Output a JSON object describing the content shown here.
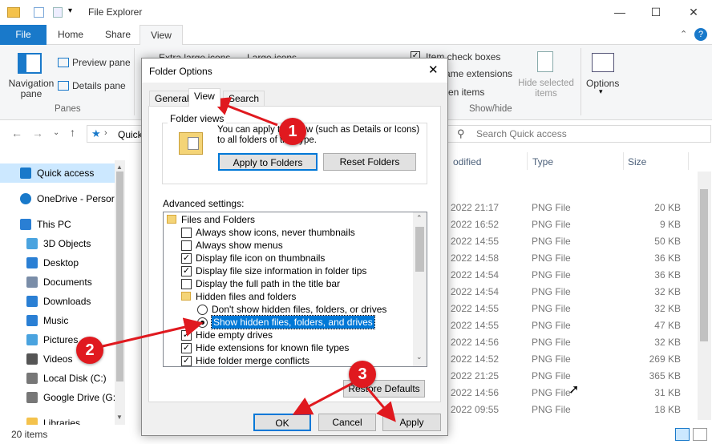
{
  "window": {
    "title": "File Explorer",
    "tabs": [
      "File",
      "Home",
      "Share",
      "View"
    ],
    "status_items": "20 items"
  },
  "ribbon": {
    "navigation_pane": "Navigation pane",
    "preview_pane": "Preview pane",
    "details_pane": "Details pane",
    "panes_group": "Panes",
    "extra_large_icons": "Extra large icons",
    "large_icons": "Large icons",
    "item_check_boxes": "Item check boxes",
    "file_name_extensions": "ame extensions",
    "hidden_items": "en items",
    "hide_selected_items": "Hide selected items",
    "show_hide_group": "Show/hide",
    "options": "Options"
  },
  "nav": {
    "address": "Quick",
    "search_placeholder": "Search Quick access"
  },
  "sidebar": {
    "items": [
      {
        "label": "Quick access",
        "icon": "star-icon"
      },
      {
        "label": "OneDrive - Persor",
        "icon": "cloud-icon"
      },
      {
        "label": "This PC",
        "icon": "computer-icon"
      },
      {
        "label": "3D Objects",
        "icon": "cube-icon"
      },
      {
        "label": "Desktop",
        "icon": "desktop-icon"
      },
      {
        "label": "Documents",
        "icon": "document-icon"
      },
      {
        "label": "Downloads",
        "icon": "download-icon"
      },
      {
        "label": "Music",
        "icon": "music-icon"
      },
      {
        "label": "Pictures",
        "icon": "pictures-icon"
      },
      {
        "label": "Videos",
        "icon": "video-icon"
      },
      {
        "label": "Local Disk (C:)",
        "icon": "drive-icon"
      },
      {
        "label": "Google Drive (G:",
        "icon": "drive-icon"
      },
      {
        "label": "Libraries",
        "icon": "library-icon"
      }
    ]
  },
  "file_list": {
    "columns": [
      "odified",
      "Type",
      "Size"
    ],
    "rows": [
      {
        "modified": "2022 21:17",
        "type": "PNG File",
        "size": "20 KB"
      },
      {
        "modified": "2022 16:52",
        "type": "PNG File",
        "size": "9 KB"
      },
      {
        "modified": "2022 14:55",
        "type": "PNG File",
        "size": "50 KB"
      },
      {
        "modified": "2022 14:58",
        "type": "PNG File",
        "size": "36 KB"
      },
      {
        "modified": "2022 14:54",
        "type": "PNG File",
        "size": "36 KB"
      },
      {
        "modified": "2022 14:54",
        "type": "PNG File",
        "size": "32 KB"
      },
      {
        "modified": "2022 14:55",
        "type": "PNG File",
        "size": "32 KB"
      },
      {
        "modified": "2022 14:55",
        "type": "PNG File",
        "size": "47 KB"
      },
      {
        "modified": "2022 14:56",
        "type": "PNG File",
        "size": "32 KB"
      },
      {
        "modified": "2022 14:52",
        "type": "PNG File",
        "size": "269 KB"
      },
      {
        "modified": "2022 21:25",
        "type": "PNG File",
        "size": "365 KB"
      },
      {
        "modified": "2022 14:56",
        "type": "PNG File",
        "size": "31 KB"
      },
      {
        "modified": "2022 09:55",
        "type": "PNG File",
        "size": "18 KB"
      }
    ]
  },
  "dialog": {
    "title": "Folder Options",
    "tabs": [
      "General",
      "View",
      "Search"
    ],
    "folder_views_label": "Folder views",
    "folder_views_text": "You can apply this view (such as Details or Icons) to all folders of this type.",
    "apply_to_folders": "Apply to Folders",
    "reset_folders": "Reset Folders",
    "advanced_label": "Advanced settings:",
    "settings": [
      {
        "kind": "folder",
        "label": "Files and Folders"
      },
      {
        "kind": "check",
        "checked": false,
        "label": "Always show icons, never thumbnails"
      },
      {
        "kind": "check",
        "checked": false,
        "label": "Always show menus"
      },
      {
        "kind": "check",
        "checked": true,
        "label": "Display file icon on thumbnails"
      },
      {
        "kind": "check",
        "checked": true,
        "label": "Display file size information in folder tips"
      },
      {
        "kind": "check",
        "checked": false,
        "label": "Display the full path in the title bar"
      },
      {
        "kind": "folder",
        "label": "Hidden files and folders"
      },
      {
        "kind": "radio",
        "checked": false,
        "label": "Don't show hidden files, folders, or drives"
      },
      {
        "kind": "radio",
        "checked": true,
        "label": "Show hidden files, folders, and drives"
      },
      {
        "kind": "check",
        "checked": true,
        "label": "Hide empty drives"
      },
      {
        "kind": "check",
        "checked": true,
        "label": "Hide extensions for known file types"
      },
      {
        "kind": "check",
        "checked": true,
        "label": "Hide folder merge conflicts"
      }
    ],
    "restore_defaults": "Restore Defaults",
    "ok": "OK",
    "cancel": "Cancel",
    "apply": "Apply"
  },
  "annotations": {
    "badge1": "1",
    "badge2": "2",
    "badge3": "3",
    "color": "#e0191f"
  }
}
